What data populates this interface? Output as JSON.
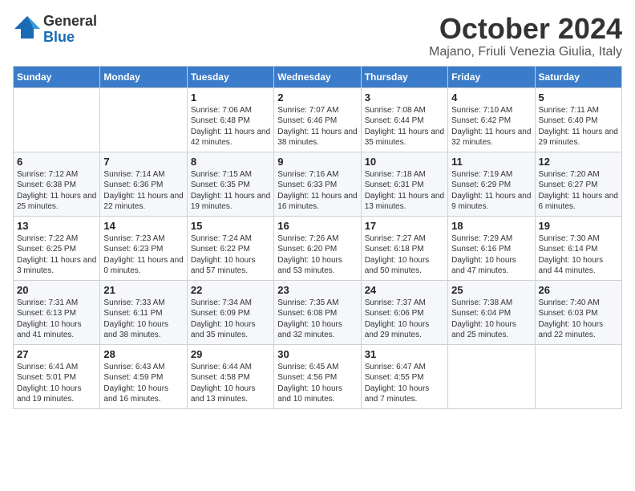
{
  "header": {
    "logo_general": "General",
    "logo_blue": "Blue",
    "month": "October 2024",
    "location": "Majano, Friuli Venezia Giulia, Italy"
  },
  "weekdays": [
    "Sunday",
    "Monday",
    "Tuesday",
    "Wednesday",
    "Thursday",
    "Friday",
    "Saturday"
  ],
  "weeks": [
    [
      {
        "day": "",
        "sunrise": "",
        "sunset": "",
        "daylight": ""
      },
      {
        "day": "",
        "sunrise": "",
        "sunset": "",
        "daylight": ""
      },
      {
        "day": "1",
        "sunrise": "Sunrise: 7:06 AM",
        "sunset": "Sunset: 6:48 PM",
        "daylight": "Daylight: 11 hours and 42 minutes."
      },
      {
        "day": "2",
        "sunrise": "Sunrise: 7:07 AM",
        "sunset": "Sunset: 6:46 PM",
        "daylight": "Daylight: 11 hours and 38 minutes."
      },
      {
        "day": "3",
        "sunrise": "Sunrise: 7:08 AM",
        "sunset": "Sunset: 6:44 PM",
        "daylight": "Daylight: 11 hours and 35 minutes."
      },
      {
        "day": "4",
        "sunrise": "Sunrise: 7:10 AM",
        "sunset": "Sunset: 6:42 PM",
        "daylight": "Daylight: 11 hours and 32 minutes."
      },
      {
        "day": "5",
        "sunrise": "Sunrise: 7:11 AM",
        "sunset": "Sunset: 6:40 PM",
        "daylight": "Daylight: 11 hours and 29 minutes."
      }
    ],
    [
      {
        "day": "6",
        "sunrise": "Sunrise: 7:12 AM",
        "sunset": "Sunset: 6:38 PM",
        "daylight": "Daylight: 11 hours and 25 minutes."
      },
      {
        "day": "7",
        "sunrise": "Sunrise: 7:14 AM",
        "sunset": "Sunset: 6:36 PM",
        "daylight": "Daylight: 11 hours and 22 minutes."
      },
      {
        "day": "8",
        "sunrise": "Sunrise: 7:15 AM",
        "sunset": "Sunset: 6:35 PM",
        "daylight": "Daylight: 11 hours and 19 minutes."
      },
      {
        "day": "9",
        "sunrise": "Sunrise: 7:16 AM",
        "sunset": "Sunset: 6:33 PM",
        "daylight": "Daylight: 11 hours and 16 minutes."
      },
      {
        "day": "10",
        "sunrise": "Sunrise: 7:18 AM",
        "sunset": "Sunset: 6:31 PM",
        "daylight": "Daylight: 11 hours and 13 minutes."
      },
      {
        "day": "11",
        "sunrise": "Sunrise: 7:19 AM",
        "sunset": "Sunset: 6:29 PM",
        "daylight": "Daylight: 11 hours and 9 minutes."
      },
      {
        "day": "12",
        "sunrise": "Sunrise: 7:20 AM",
        "sunset": "Sunset: 6:27 PM",
        "daylight": "Daylight: 11 hours and 6 minutes."
      }
    ],
    [
      {
        "day": "13",
        "sunrise": "Sunrise: 7:22 AM",
        "sunset": "Sunset: 6:25 PM",
        "daylight": "Daylight: 11 hours and 3 minutes."
      },
      {
        "day": "14",
        "sunrise": "Sunrise: 7:23 AM",
        "sunset": "Sunset: 6:23 PM",
        "daylight": "Daylight: 11 hours and 0 minutes."
      },
      {
        "day": "15",
        "sunrise": "Sunrise: 7:24 AM",
        "sunset": "Sunset: 6:22 PM",
        "daylight": "Daylight: 10 hours and 57 minutes."
      },
      {
        "day": "16",
        "sunrise": "Sunrise: 7:26 AM",
        "sunset": "Sunset: 6:20 PM",
        "daylight": "Daylight: 10 hours and 53 minutes."
      },
      {
        "day": "17",
        "sunrise": "Sunrise: 7:27 AM",
        "sunset": "Sunset: 6:18 PM",
        "daylight": "Daylight: 10 hours and 50 minutes."
      },
      {
        "day": "18",
        "sunrise": "Sunrise: 7:29 AM",
        "sunset": "Sunset: 6:16 PM",
        "daylight": "Daylight: 10 hours and 47 minutes."
      },
      {
        "day": "19",
        "sunrise": "Sunrise: 7:30 AM",
        "sunset": "Sunset: 6:14 PM",
        "daylight": "Daylight: 10 hours and 44 minutes."
      }
    ],
    [
      {
        "day": "20",
        "sunrise": "Sunrise: 7:31 AM",
        "sunset": "Sunset: 6:13 PM",
        "daylight": "Daylight: 10 hours and 41 minutes."
      },
      {
        "day": "21",
        "sunrise": "Sunrise: 7:33 AM",
        "sunset": "Sunset: 6:11 PM",
        "daylight": "Daylight: 10 hours and 38 minutes."
      },
      {
        "day": "22",
        "sunrise": "Sunrise: 7:34 AM",
        "sunset": "Sunset: 6:09 PM",
        "daylight": "Daylight: 10 hours and 35 minutes."
      },
      {
        "day": "23",
        "sunrise": "Sunrise: 7:35 AM",
        "sunset": "Sunset: 6:08 PM",
        "daylight": "Daylight: 10 hours and 32 minutes."
      },
      {
        "day": "24",
        "sunrise": "Sunrise: 7:37 AM",
        "sunset": "Sunset: 6:06 PM",
        "daylight": "Daylight: 10 hours and 29 minutes."
      },
      {
        "day": "25",
        "sunrise": "Sunrise: 7:38 AM",
        "sunset": "Sunset: 6:04 PM",
        "daylight": "Daylight: 10 hours and 25 minutes."
      },
      {
        "day": "26",
        "sunrise": "Sunrise: 7:40 AM",
        "sunset": "Sunset: 6:03 PM",
        "daylight": "Daylight: 10 hours and 22 minutes."
      }
    ],
    [
      {
        "day": "27",
        "sunrise": "Sunrise: 6:41 AM",
        "sunset": "Sunset: 5:01 PM",
        "daylight": "Daylight: 10 hours and 19 minutes."
      },
      {
        "day": "28",
        "sunrise": "Sunrise: 6:43 AM",
        "sunset": "Sunset: 4:59 PM",
        "daylight": "Daylight: 10 hours and 16 minutes."
      },
      {
        "day": "29",
        "sunrise": "Sunrise: 6:44 AM",
        "sunset": "Sunset: 4:58 PM",
        "daylight": "Daylight: 10 hours and 13 minutes."
      },
      {
        "day": "30",
        "sunrise": "Sunrise: 6:45 AM",
        "sunset": "Sunset: 4:56 PM",
        "daylight": "Daylight: 10 hours and 10 minutes."
      },
      {
        "day": "31",
        "sunrise": "Sunrise: 6:47 AM",
        "sunset": "Sunset: 4:55 PM",
        "daylight": "Daylight: 10 hours and 7 minutes."
      },
      {
        "day": "",
        "sunrise": "",
        "sunset": "",
        "daylight": ""
      },
      {
        "day": "",
        "sunrise": "",
        "sunset": "",
        "daylight": ""
      }
    ]
  ]
}
